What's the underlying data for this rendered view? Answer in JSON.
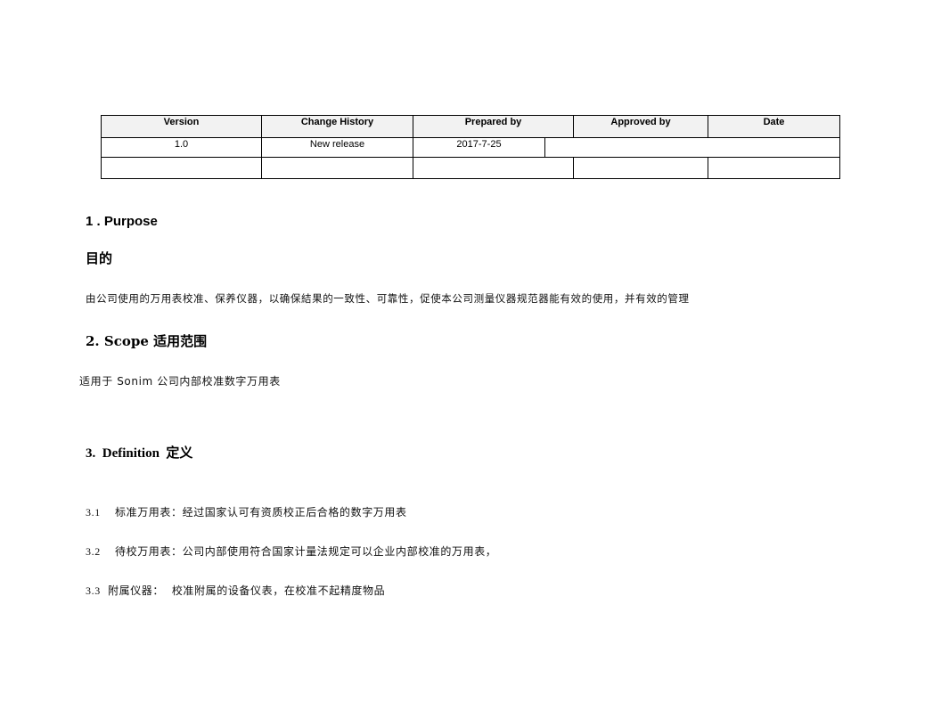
{
  "revision_table": {
    "headers": [
      "Version",
      "Change History",
      "Prepared by",
      "Approved by",
      "Date"
    ],
    "rows": [
      [
        "1.0",
        "New release",
        "2017-7-25",
        "",
        ""
      ],
      [
        "",
        "",
        "",
        "",
        ""
      ]
    ]
  },
  "sections": {
    "purpose": {
      "heading_en": "1 . Purpose",
      "heading_cn": "目的",
      "body": "由公司使用的万用表校准、保养仪器，以确保結果的一致性、可靠性，促使本公司测量仪器规范器能有效的使用，并有效的管理"
    },
    "scope": {
      "heading": "2. Scope  适用范围",
      "body": "适用于 Sonim 公司内部校准数字万用表"
    },
    "definition": {
      "heading": "3.  Definition  定义",
      "items": [
        {
          "num": "3.1",
          "text": "标准万用表：经过国家认可有资质校正后合格的数字万用表"
        },
        {
          "num": "3.2",
          "text": "待校万用表：公司内部使用符合国家计量法规定可以企业内部校准的万用表，"
        },
        {
          "num": "3.3",
          "text": "附属仪器：  校准附属的设备仪表，在校准不起精度物品"
        }
      ]
    }
  }
}
